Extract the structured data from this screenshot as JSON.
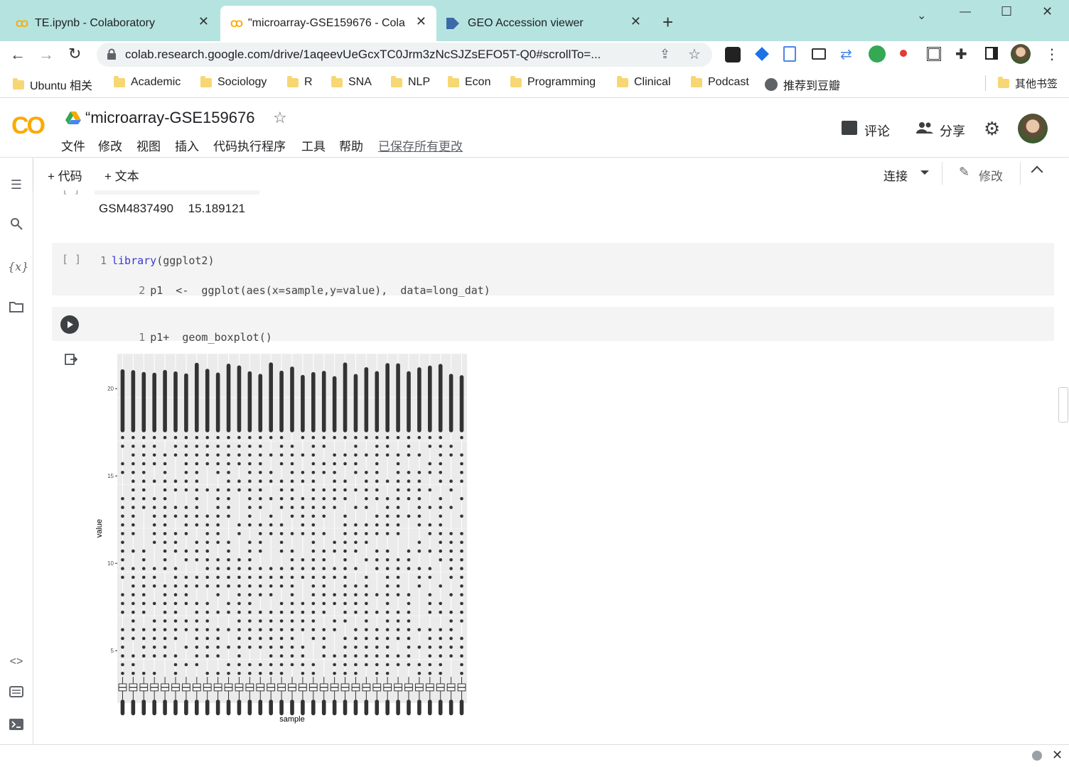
{
  "browser": {
    "tabs": [
      {
        "title": "TE.ipynb - Colaboratory",
        "icon": "colab-icon"
      },
      {
        "title": "\"microarray-GSE159676 - Cola",
        "icon": "colab-icon"
      },
      {
        "title": "GEO Accession viewer",
        "icon": "geo-icon"
      }
    ],
    "new_tab": "+",
    "address": "colab.research.google.com/drive/1aqeevUeGcxTC0Jrm3zNcSJZsEFO5T-Q0#scrollTo=...",
    "window_controls": {
      "minimize": "—",
      "maximize": "☐",
      "close": "✕"
    }
  },
  "bookmarks": [
    "Ubuntu 相关",
    "Academic",
    "Sociology",
    "R",
    "SNA",
    "NLP",
    "Econ",
    "Programming",
    "Clinical",
    "Podcast",
    "推荐到豆瓣"
  ],
  "other_bookmarks": "其他书签",
  "colab": {
    "logo": "CO",
    "notebook_title": "“microarray-GSE159676",
    "menu": [
      "文件",
      "修改",
      "视图",
      "插入",
      "代码执行程序",
      "工具",
      "帮助"
    ],
    "saved_status": "已保存所有更改",
    "comment_label": "评论",
    "share_label": "分享",
    "toolbar": {
      "add_code": "+ 代码",
      "add_text": "+ 文本",
      "connect": "连接",
      "edit": "修改"
    }
  },
  "output_prev": {
    "sample_id": "GSM4837490",
    "value": "15.189121"
  },
  "cell1": {
    "run_indicator": "[ ]",
    "lines": [
      {
        "num": "1",
        "kw": "library",
        "rest": "(ggplot2)"
      },
      {
        "num": "2",
        "kw": "",
        "rest": "p1  <-  ggplot(aes(x=sample,y=value),  data=long_dat)"
      }
    ]
  },
  "cell2": {
    "lines": [
      {
        "num": "1",
        "kw": "",
        "rest": "p1+  geom_boxplot()"
      }
    ]
  },
  "chart_data": {
    "type": "boxplot",
    "title": "",
    "xlabel": "sample",
    "ylabel": "value",
    "ylim": [
      2,
      22
    ],
    "yticks": [
      5,
      10,
      15,
      20
    ],
    "n_samples": 33,
    "categories": [],
    "box": {
      "q1": 2.7,
      "median": 2.9,
      "q3": 3.1,
      "whisker_low": 1.3,
      "whisker_high": 3.5
    },
    "outliers_range": [
      3.7,
      21.5
    ],
    "grid": true,
    "background": "#ebebeb"
  },
  "colors": {
    "tabbar": "#b5e3e0",
    "colab_orange": "#f9ab00",
    "link_blue": "#3a39d4"
  }
}
